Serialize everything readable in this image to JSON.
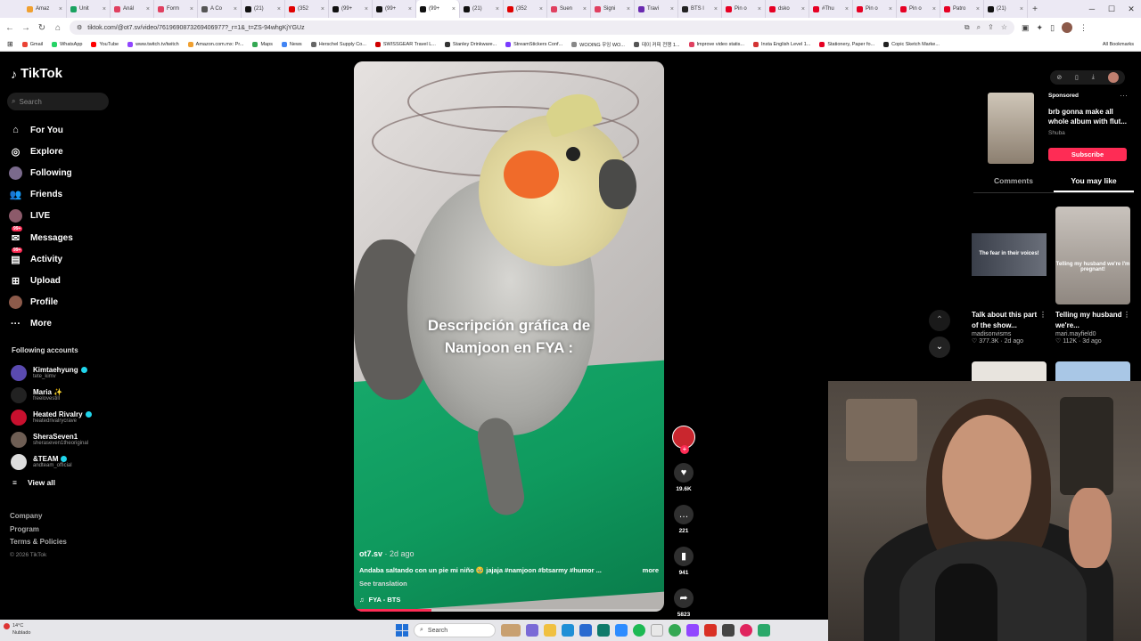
{
  "browser": {
    "tabs": [
      {
        "label": "Amaz",
        "color": "#f0a030"
      },
      {
        "label": "Unit",
        "color": "#1aa260"
      },
      {
        "label": "Anál",
        "color": "#e04060"
      },
      {
        "label": "Form",
        "color": "#e04060"
      },
      {
        "label": "A Co",
        "color": "#555555"
      },
      {
        "label": "(21)",
        "color": "#111111"
      },
      {
        "label": "(352",
        "color": "#e00000"
      },
      {
        "label": "(99+",
        "color": "#111111"
      },
      {
        "label": "(99+",
        "color": "#111111"
      },
      {
        "label": "(99+",
        "color": "#111111",
        "active": true
      },
      {
        "label": "(21)",
        "color": "#111111"
      },
      {
        "label": "(352",
        "color": "#e00000"
      },
      {
        "label": "Suen",
        "color": "#e04060"
      },
      {
        "label": "Signi",
        "color": "#e04060"
      },
      {
        "label": "Travi",
        "color": "#6a2ab0"
      },
      {
        "label": "BTS l",
        "color": "#222222"
      },
      {
        "label": "Pin o",
        "color": "#e60023"
      },
      {
        "label": "dsko",
        "color": "#e60023"
      },
      {
        "label": "#Thu",
        "color": "#e60023"
      },
      {
        "label": "Pin o",
        "color": "#e60023"
      },
      {
        "label": "Pin o",
        "color": "#e60023"
      },
      {
        "label": "Patro",
        "color": "#e60023"
      },
      {
        "label": "(21)",
        "color": "#111111"
      }
    ],
    "url": "tiktok.com/@ot7.sv/video/7619690873269406977?_r=1&_t=ZS-94whgKjYGUz",
    "bookmarks": [
      {
        "label": "Gmail",
        "color": "#ea4335"
      },
      {
        "label": "WhatsApp",
        "color": "#25d366"
      },
      {
        "label": "YouTube",
        "color": "#ff0000"
      },
      {
        "label": "www.twitch.tv/twitch",
        "color": "#9146ff"
      },
      {
        "label": "Amazon.com.mx: Pr...",
        "color": "#f0a030"
      },
      {
        "label": "Maps",
        "color": "#34a853"
      },
      {
        "label": "News",
        "color": "#4285f4"
      },
      {
        "label": "Herschel Supply Co...",
        "color": "#666666"
      },
      {
        "label": "SWISSGEAR Travel L...",
        "color": "#d00000"
      },
      {
        "label": "Stanley Drinkware...",
        "color": "#333333"
      },
      {
        "label": "StreamStickers Conf...",
        "color": "#7a3cff"
      },
      {
        "label": "WOOING 우잉 WO...",
        "color": "#888888"
      },
      {
        "label": "데이 커피 전쟁 1...",
        "color": "#555555"
      },
      {
        "label": "Improve video statis...",
        "color": "#e04060"
      },
      {
        "label": "Insta English Level 1...",
        "color": "#d33333"
      },
      {
        "label": "Stationery, Paper fo...",
        "color": "#e60023"
      },
      {
        "label": "Copic Sketch Marke...",
        "color": "#222222"
      }
    ],
    "all_bookmarks": "All Bookmarks"
  },
  "sidebar": {
    "brand": "TikTok",
    "search_placeholder": "Search",
    "nav": [
      {
        "label": "For You",
        "icon": "home-icon",
        "glyph": "⌂"
      },
      {
        "label": "Explore",
        "icon": "compass-icon",
        "glyph": "◎"
      },
      {
        "label": "Following",
        "icon": "following-avatar-icon",
        "glyph": ""
      },
      {
        "label": "Friends",
        "icon": "friends-icon",
        "glyph": "👥"
      },
      {
        "label": "LIVE",
        "icon": "live-avatar-icon",
        "glyph": ""
      },
      {
        "label": "Messages",
        "icon": "messages-icon",
        "glyph": "✉",
        "badge": "99+"
      },
      {
        "label": "Activity",
        "icon": "activity-icon",
        "glyph": "▤",
        "badge": "99+"
      },
      {
        "label": "Upload",
        "icon": "upload-icon",
        "glyph": "⊞"
      },
      {
        "label": "Profile",
        "icon": "profile-avatar-icon",
        "glyph": ""
      },
      {
        "label": "More",
        "icon": "more-icon",
        "glyph": "···"
      }
    ],
    "following_title": "Following accounts",
    "accounts": [
      {
        "name": "Kimtaehyung",
        "handle": "tete_kimv",
        "verified": true,
        "color": "#5a4ab0"
      },
      {
        "name": "Maria ✨",
        "handle": "freelovestill",
        "verified": false,
        "color": "#222222"
      },
      {
        "name": "Heated Rivalry",
        "handle": "heatedrivalrycrave",
        "verified": true,
        "color": "#c8102e"
      },
      {
        "name": "SheraSeven1",
        "handle": "sheraseven1theoriginal",
        "verified": false,
        "color": "#6e5e54"
      },
      {
        "name": "&TEAM",
        "handle": "andteam_official",
        "verified": true,
        "color": "#dddddd"
      }
    ],
    "view_all": "View all",
    "footer": [
      "Company",
      "Program",
      "Terms & Policies"
    ],
    "copyright": "© 2026 TikTok"
  },
  "video": {
    "caption_line1": "Descripción gráfica de",
    "caption_line2": "Namjoon en FYA :",
    "username": "ot7.sv",
    "date": " · 2d ago",
    "description": "Andaba saltando con un pie mi niño 🥹 jajaja #namjoon #btsarmy #humor ...",
    "more": "more",
    "see_translation": "See translation",
    "music": "FYA - BTS",
    "progress": 0.25
  },
  "actions": {
    "likes": "19.6K",
    "comments": "221",
    "saves": "941",
    "shares": "5823"
  },
  "right_panel": {
    "ad": {
      "label": "Sponsored",
      "title": "brb gonna make all whole album with flut...",
      "brand": "Shuba",
      "cta": "Subscribe"
    },
    "tabs": [
      "Comments",
      "You may like"
    ],
    "active_tab": "You may like",
    "recs": [
      {
        "title": "Talk about this part of the show...",
        "author": "madisonvisms",
        "stats": "♡ 377.3K · 2d ago",
        "overlay": "The fear in their voices!"
      },
      {
        "title": "Telling my husband we're...",
        "author": "mari.mayfield0",
        "stats": "♡ 112K · 3d ago",
        "overlay": "Telling my husband we're I'm pregnant!"
      }
    ]
  },
  "taskbar": {
    "temp": "14°C",
    "weather": "Nublado",
    "search_label": "Search"
  }
}
